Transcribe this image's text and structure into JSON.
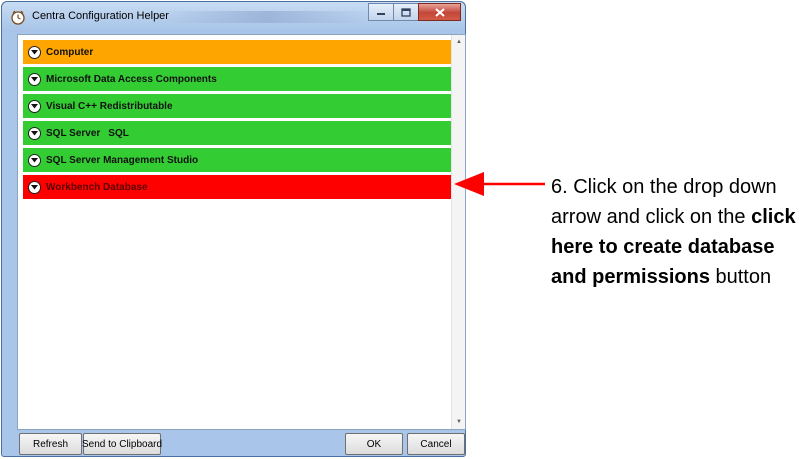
{
  "window": {
    "title": "Centra Configuration Helper",
    "icons": {
      "app": "clock-icon",
      "minimize": "minimize-icon",
      "maximize": "maximize-icon",
      "close": "close-icon"
    }
  },
  "sections": [
    {
      "label": "Computer",
      "color": "#ffa500",
      "icon": "chevron-down-icon"
    },
    {
      "label": "Microsoft Data Access Components",
      "color": "#33cc33",
      "icon": "chevron-down-icon"
    },
    {
      "label": "Visual C++ Redistributable",
      "color": "#33cc33",
      "icon": "chevron-down-icon"
    },
    {
      "label": "SQL Server",
      "extra": "SQL",
      "color": "#33cc33",
      "icon": "chevron-down-icon"
    },
    {
      "label": "SQL Server Management Studio",
      "color": "#33cc33",
      "icon": "chevron-down-icon"
    },
    {
      "label": "Workbench Database",
      "color": "#ff0000",
      "icon": "chevron-down-icon"
    }
  ],
  "buttons": {
    "refresh": "Refresh",
    "clipboard": "Send to Clipboard",
    "ok": "OK",
    "cancel": "Cancel"
  },
  "callout": {
    "part1": "6. Click on the drop down arrow and click on the ",
    "bold1": "click here to create database and permissions",
    "part2": " button",
    "arrow_color": "#ff0000"
  }
}
